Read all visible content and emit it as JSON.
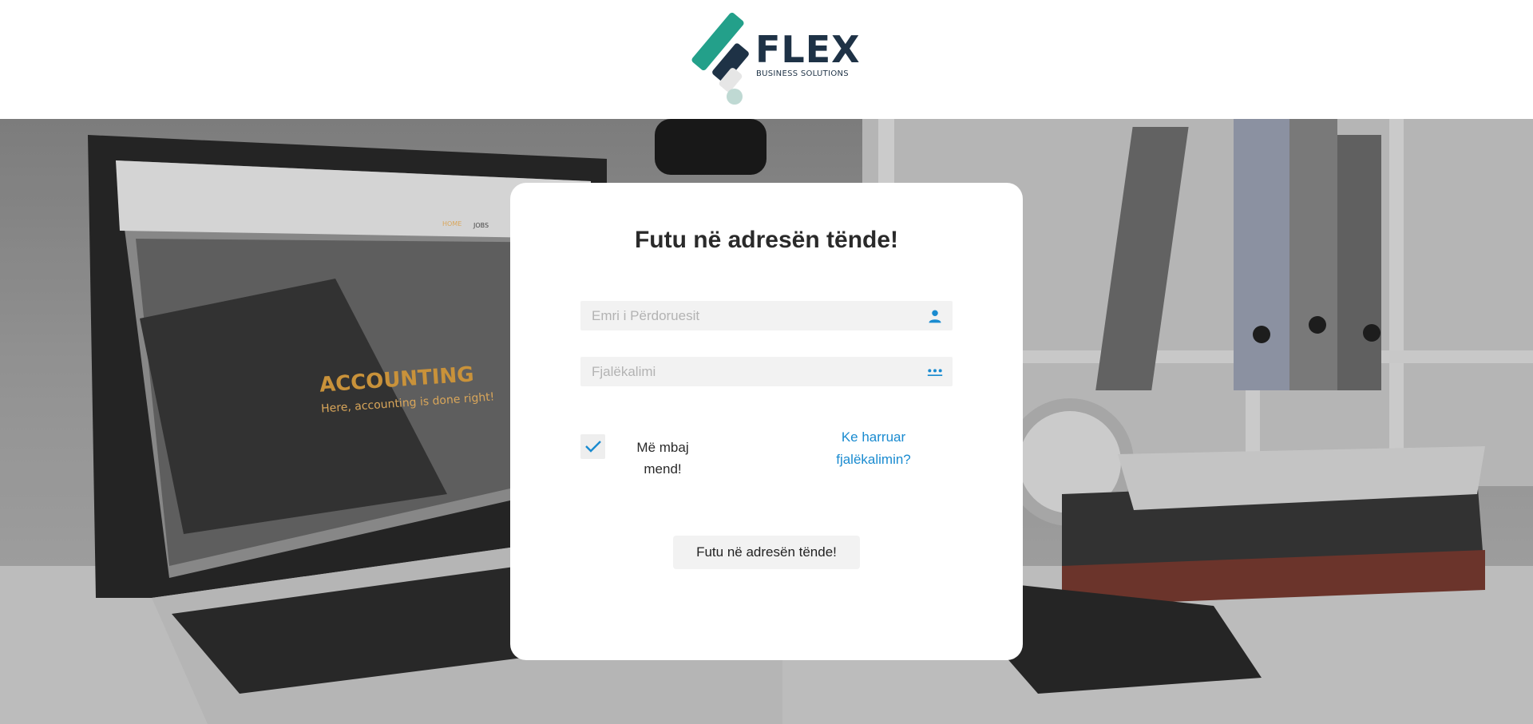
{
  "brand": {
    "name": "FLEX",
    "tagline": "BUSINESS SOLUTIONS"
  },
  "login": {
    "title": "Futu në adresën tënde!",
    "username_placeholder": "Emri i Përdoruesit",
    "username_value": "",
    "password_placeholder": "Fjalëkalimi",
    "password_value": "",
    "remember_label": "Më mbaj mend!",
    "remember_checked": true,
    "forgot_label": "Ke harruar fjalëkalimin?",
    "submit_label": "Futu në adresën tënde!"
  },
  "background": {
    "laptop_screen_heading": "ACCOUNTING",
    "laptop_screen_subheading": "Here, accounting is done right!",
    "laptop_screen_nav": [
      "HOME",
      "JOBS"
    ]
  },
  "colors": {
    "accent": "#1a8bd0",
    "brand_teal": "#23a08a",
    "brand_navy": "#1e3246"
  },
  "icons": {
    "username": "person-icon",
    "password": "dots-icon",
    "checkbox": "checkmark-icon"
  }
}
